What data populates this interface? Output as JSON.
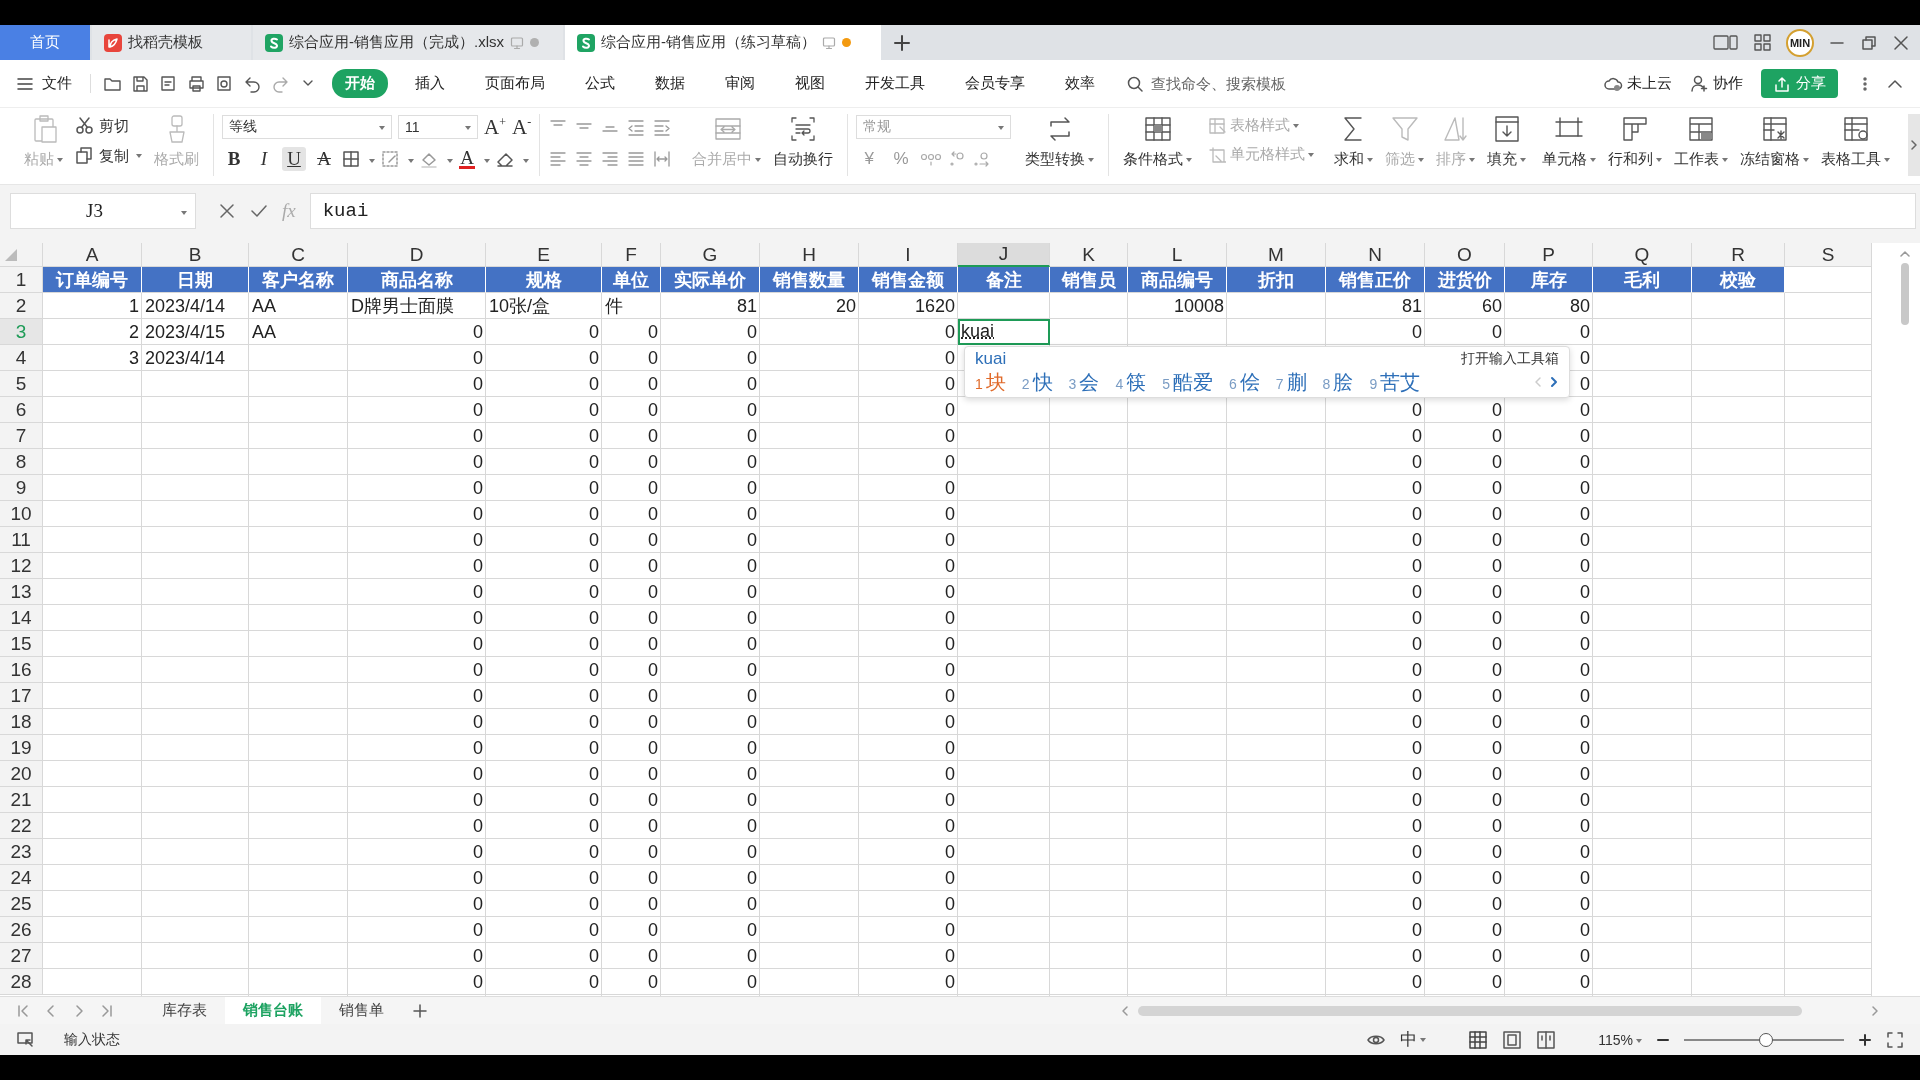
{
  "window": {
    "tabs": [
      {
        "kind": "home",
        "title": "首页",
        "selected": false
      },
      {
        "kind": "template",
        "title": "找稻壳模板",
        "selected": false
      },
      {
        "kind": "document",
        "title": "综合应用-销售应用（完成）.xlsx",
        "selected": false,
        "modified": false
      },
      {
        "kind": "document",
        "title": "综合应用-销售应用（练习草稿）",
        "selected": true,
        "modified": true
      }
    ],
    "avatar": "MIN"
  },
  "menu": {
    "file": "文件",
    "tabs": [
      {
        "label": "开始",
        "selected": true
      },
      {
        "label": "插入",
        "selected": false
      },
      {
        "label": "页面布局",
        "selected": false
      },
      {
        "label": "公式",
        "selected": false
      },
      {
        "label": "数据",
        "selected": false
      },
      {
        "label": "审阅",
        "selected": false
      },
      {
        "label": "视图",
        "selected": false
      },
      {
        "label": "开发工具",
        "selected": false
      },
      {
        "label": "会员专享",
        "selected": false
      },
      {
        "label": "效率",
        "selected": false
      }
    ],
    "search": {
      "placeholder": "查找命令、搜索模板"
    },
    "cloud": "未上云",
    "collaborate": "协作",
    "share": "分享"
  },
  "ribbon": {
    "clipboard": {
      "paste": {
        "label": "粘贴",
        "disabled": true
      },
      "cut": {
        "label": "剪切",
        "disabled": false
      },
      "copy": {
        "label": "复制",
        "disabled": false
      },
      "format_painter": {
        "label": "格式刷",
        "disabled": true
      }
    },
    "font": {
      "name": "等线",
      "size": "11",
      "grow": "A$^{+}$",
      "shrink": "A$^{-}$",
      "styles": [
        {
          "kind": "bold",
          "label": "B",
          "on": false
        },
        {
          "kind": "italic",
          "label": "I",
          "on": false
        },
        {
          "kind": "underline",
          "label": "U",
          "on": true
        },
        {
          "kind": "strike",
          "label": "A",
          "on": false
        }
      ],
      "font_color": {
        "label": "A",
        "color": "#e02020"
      }
    },
    "alignment": {
      "merge": "合并居中",
      "wrap": "自动换行"
    },
    "number": {
      "format": "常规",
      "symbols": [
        "¥",
        "%"
      ],
      "convert": "类型转换"
    },
    "tools": [
      {
        "kind": "large",
        "label": "条件格式",
        "disabled": false
      },
      {
        "kind": "stack",
        "items": [
          {
            "label": "表格样式",
            "disabled": true
          },
          {
            "label": "单元格样式",
            "disabled": true
          }
        ]
      },
      {
        "kind": "large",
        "label": "求和",
        "disabled": false
      },
      {
        "kind": "large",
        "label": "筛选",
        "disabled": true
      },
      {
        "kind": "large",
        "label": "排序",
        "disabled": true
      },
      {
        "kind": "large",
        "label": "填充",
        "disabled": false
      },
      {
        "kind": "large",
        "label": "单元格",
        "disabled": false
      },
      {
        "kind": "large",
        "label": "行和列",
        "disabled": false
      },
      {
        "kind": "large",
        "label": "工作表",
        "disabled": false
      },
      {
        "kind": "large",
        "label": "冻结窗格",
        "disabled": false
      },
      {
        "kind": "large",
        "label": "表格工具",
        "disabled": false
      }
    ]
  },
  "formula_bar": {
    "cell": "J3",
    "function_label": "fx",
    "value": "kuai"
  },
  "sheet": {
    "columns": [
      {
        "label": "A",
        "selected": false
      },
      {
        "label": "B",
        "selected": false
      },
      {
        "label": "C",
        "selected": false
      },
      {
        "label": "D",
        "selected": false
      },
      {
        "label": "E",
        "selected": false
      },
      {
        "label": "F",
        "selected": false
      },
      {
        "label": "G",
        "selected": false
      },
      {
        "label": "H",
        "selected": false
      },
      {
        "label": "I",
        "selected": false
      },
      {
        "label": "J",
        "selected": true
      },
      {
        "label": "K",
        "selected": false
      },
      {
        "label": "L",
        "selected": false
      },
      {
        "label": "M",
        "selected": false
      },
      {
        "label": "N",
        "selected": false
      },
      {
        "label": "O",
        "selected": false
      },
      {
        "label": "P",
        "selected": false
      },
      {
        "label": "Q",
        "selected": false
      },
      {
        "label": "R",
        "selected": false
      },
      {
        "label": "S",
        "selected": false
      }
    ],
    "header_row": {
      "label": "1",
      "selected": false,
      "cells": {
        "A": "订单编号",
        "B": "日期",
        "C": "客户名称",
        "D": "商品名称",
        "E": "规格",
        "F": "单位",
        "G": "实际单价",
        "H": "销售数量",
        "I": "销售金额",
        "J": "备注",
        "K": "销售员",
        "L": "商品编号",
        "M": "折扣",
        "N": "销售正价",
        "O": "进货价",
        "P": "库存",
        "Q": "毛利",
        "R": "校验"
      }
    },
    "rows": [
      {
        "label": "2",
        "selected": false,
        "cells": {
          "A": "1",
          "B": "2023/4/14",
          "C": "AA",
          "D": "D牌男士面膜",
          "E": "10张/盒",
          "F": "件",
          "G": "81",
          "H": "20",
          "I": "1620",
          "L": "10008",
          "N": "81",
          "O": "60",
          "P": "80"
        }
      },
      {
        "label": "3",
        "selected": true,
        "cells": {
          "A": "2",
          "B": "2023/4/15",
          "C": "AA",
          "D": "0",
          "E": "0",
          "F": "0",
          "G": "0",
          "I": "0",
          "J": "kuai",
          "N": "0",
          "O": "0",
          "P": "0"
        }
      },
      {
        "label": "4",
        "selected": false,
        "cells": {
          "A": "3",
          "B": "2023/4/14",
          "D": "0",
          "E": "0",
          "F": "0",
          "G": "0",
          "I": "0",
          "P": "0"
        }
      },
      {
        "label": "5",
        "selected": false,
        "cells": {
          "D": "0",
          "E": "0",
          "F": "0",
          "G": "0",
          "I": "0",
          "P": "0"
        }
      },
      {
        "label": "6",
        "selected": false,
        "cells": {
          "D": "0",
          "E": "0",
          "F": "0",
          "G": "0",
          "I": "0",
          "N": "0",
          "O": "0",
          "P": "0"
        }
      },
      {
        "label": "7",
        "selected": false,
        "cells": {
          "D": "0",
          "E": "0",
          "F": "0",
          "G": "0",
          "I": "0",
          "N": "0",
          "O": "0",
          "P": "0"
        }
      },
      {
        "label": "8",
        "selected": false,
        "cells": {
          "D": "0",
          "E": "0",
          "F": "0",
          "G": "0",
          "I": "0",
          "N": "0",
          "O": "0",
          "P": "0"
        }
      },
      {
        "label": "9",
        "selected": false,
        "cells": {
          "D": "0",
          "E": "0",
          "F": "0",
          "G": "0",
          "I": "0",
          "N": "0",
          "O": "0",
          "P": "0"
        }
      },
      {
        "label": "10",
        "selected": false,
        "cells": {
          "D": "0",
          "E": "0",
          "F": "0",
          "G": "0",
          "I": "0",
          "N": "0",
          "O": "0",
          "P": "0"
        }
      },
      {
        "label": "11",
        "selected": false,
        "cells": {
          "D": "0",
          "E": "0",
          "F": "0",
          "G": "0",
          "I": "0",
          "N": "0",
          "O": "0",
          "P": "0"
        }
      },
      {
        "label": "12",
        "selected": false,
        "cells": {
          "D": "0",
          "E": "0",
          "F": "0",
          "G": "0",
          "I": "0",
          "N": "0",
          "O": "0",
          "P": "0"
        }
      },
      {
        "label": "13",
        "selected": false,
        "cells": {
          "D": "0",
          "E": "0",
          "F": "0",
          "G": "0",
          "I": "0",
          "N": "0",
          "O": "0",
          "P": "0"
        }
      },
      {
        "label": "14",
        "selected": false,
        "cells": {
          "D": "0",
          "E": "0",
          "F": "0",
          "G": "0",
          "I": "0",
          "N": "0",
          "O": "0",
          "P": "0"
        }
      },
      {
        "label": "15",
        "selected": false,
        "cells": {
          "D": "0",
          "E": "0",
          "F": "0",
          "G": "0",
          "I": "0",
          "N": "0",
          "O": "0",
          "P": "0"
        }
      },
      {
        "label": "16",
        "selected": false,
        "cells": {
          "D": "0",
          "E": "0",
          "F": "0",
          "G": "0",
          "I": "0",
          "N": "0",
          "O": "0",
          "P": "0"
        }
      },
      {
        "label": "17",
        "selected": false,
        "cells": {
          "D": "0",
          "E": "0",
          "F": "0",
          "G": "0",
          "I": "0",
          "N": "0",
          "O": "0",
          "P": "0"
        }
      },
      {
        "label": "18",
        "selected": false,
        "cells": {
          "D": "0",
          "E": "0",
          "F": "0",
          "G": "0",
          "I": "0",
          "N": "0",
          "O": "0",
          "P": "0"
        }
      },
      {
        "label": "19",
        "selected": false,
        "cells": {
          "D": "0",
          "E": "0",
          "F": "0",
          "G": "0",
          "I": "0",
          "N": "0",
          "O": "0",
          "P": "0"
        }
      },
      {
        "label": "20",
        "selected": false,
        "cells": {
          "D": "0",
          "E": "0",
          "F": "0",
          "G": "0",
          "I": "0",
          "N": "0",
          "O": "0",
          "P": "0"
        }
      },
      {
        "label": "21",
        "selected": false,
        "cells": {
          "D": "0",
          "E": "0",
          "F": "0",
          "G": "0",
          "I": "0",
          "N": "0",
          "O": "0",
          "P": "0"
        }
      },
      {
        "label": "22",
        "selected": false,
        "cells": {
          "D": "0",
          "E": "0",
          "F": "0",
          "G": "0",
          "I": "0",
          "N": "0",
          "O": "0",
          "P": "0"
        }
      },
      {
        "label": "23",
        "selected": false,
        "cells": {
          "D": "0",
          "E": "0",
          "F": "0",
          "G": "0",
          "I": "0",
          "N": "0",
          "O": "0",
          "P": "0"
        }
      },
      {
        "label": "24",
        "selected": false,
        "cells": {
          "D": "0",
          "E": "0",
          "F": "0",
          "G": "0",
          "I": "0",
          "N": "0",
          "O": "0",
          "P": "0"
        }
      },
      {
        "label": "25",
        "selected": false,
        "cells": {
          "D": "0",
          "E": "0",
          "F": "0",
          "G": "0",
          "I": "0",
          "N": "0",
          "O": "0",
          "P": "0"
        }
      },
      {
        "label": "26",
        "selected": false,
        "cells": {
          "D": "0",
          "E": "0",
          "F": "0",
          "G": "0",
          "I": "0",
          "N": "0",
          "O": "0",
          "P": "0"
        }
      },
      {
        "label": "27",
        "selected": false,
        "cells": {
          "D": "0",
          "E": "0",
          "F": "0",
          "G": "0",
          "I": "0",
          "N": "0",
          "O": "0",
          "P": "0"
        }
      },
      {
        "label": "28",
        "selected": false,
        "cells": {
          "D": "0",
          "E": "0",
          "F": "0",
          "G": "0",
          "I": "0",
          "N": "0",
          "O": "0",
          "P": "0"
        }
      }
    ]
  },
  "ime": {
    "input": "kuai",
    "toolbox": "打开输入工具箱",
    "candidates": [
      {
        "index": "1",
        "text": "块",
        "selected": true
      },
      {
        "index": "2",
        "text": "快",
        "selected": false
      },
      {
        "index": "3",
        "text": "会",
        "selected": false
      },
      {
        "index": "4",
        "text": "筷",
        "selected": false
      },
      {
        "index": "5",
        "text": "酷爱",
        "selected": false
      },
      {
        "index": "6",
        "text": "侩",
        "selected": false
      },
      {
        "index": "7",
        "text": "蒯",
        "selected": false
      },
      {
        "index": "8",
        "text": "脍",
        "selected": false
      },
      {
        "index": "9",
        "text": "苦艾",
        "selected": false
      }
    ],
    "prev_disabled": true
  },
  "sheet_tabs": [
    {
      "label": "库存表",
      "selected": false
    },
    {
      "label": "销售台账",
      "selected": true
    },
    {
      "label": "销售单",
      "selected": false
    }
  ],
  "status_bar": {
    "mode": "输入状态",
    "input_method": "中",
    "zoom": {
      "label": "115%",
      "level": 0.51
    }
  }
}
